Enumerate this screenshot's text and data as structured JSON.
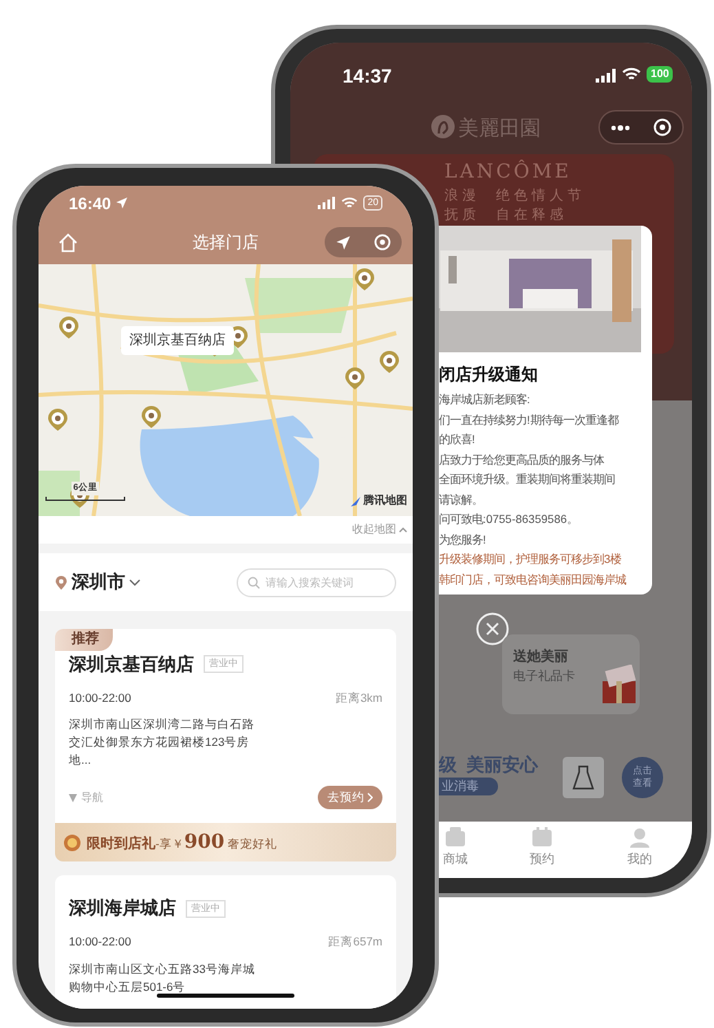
{
  "back_phone": {
    "status_bar": {
      "time": "14:37",
      "battery": "100"
    },
    "brand": "美麗田園",
    "banner": {
      "title": "LANCÔME",
      "lines": [
        "浪漫  绝色情人节",
        "抚质  自在释感"
      ]
    },
    "notice": {
      "title": "闭店升级通知",
      "lines": [
        {
          "text": "海岸城店新老顾客:",
          "kind": "normal"
        },
        {
          "text": "们一直在持续努力!期待每一次重逢都",
          "kind": "normal"
        },
        {
          "text": "的欣喜!",
          "kind": "normal"
        },
        {
          "text": "店致力于给您更高品质的服务与体",
          "kind": "normal"
        },
        {
          "text": "全面环境升级。重装期间将重装期间",
          "kind": "normal"
        },
        {
          "text": "请谅解。",
          "kind": "normal"
        },
        {
          "text": "问可致电:0755-86359586。",
          "kind": "normal"
        },
        {
          "text": "为您服务!",
          "kind": "normal"
        },
        {
          "text": "升级装修期间，护理服务可移步到3楼",
          "kind": "highlight"
        },
        {
          "text": "韩印门店，可致电咨询美丽田园海岸城",
          "kind": "highlight"
        }
      ]
    },
    "gift_card": {
      "title": "送她美丽",
      "subtitle": "电子礼品卡"
    },
    "safety": {
      "title": "级  美丽安心",
      "tag": "业消毒",
      "button": "点击查看"
    },
    "tab_bar": [
      {
        "label": "商城",
        "kind": "mall"
      },
      {
        "label": "预约",
        "kind": "booking"
      },
      {
        "label": "我的",
        "kind": "profile"
      }
    ]
  },
  "front_phone": {
    "status_bar": {
      "time": "16:40",
      "battery": "20"
    },
    "nav": {
      "title": "选择门店"
    },
    "map": {
      "callout": "深圳京基百纳店",
      "scale": "6公里",
      "attribution": "腾讯地图",
      "collapse": "收起地图"
    },
    "city": "深圳市",
    "search": {
      "placeholder": "请输入搜索关键词"
    },
    "stores": [
      {
        "badge": "推荐",
        "name": "深圳京基百纳店",
        "status": "营业中",
        "hours": "10:00-22:00",
        "distance": "距离3km",
        "address": "深圳市南山区深圳湾二路与白石路交汇处御景东方花园裙楼123号房地...",
        "navigate": "导航",
        "button": "去预约"
      },
      {
        "name": "深圳海岸城店",
        "status": "营业中",
        "hours": "10:00-22:00",
        "distance": "距离657m",
        "address": "深圳市南山区文心五路33号海岸城购物中心五层501-6号"
      }
    ],
    "promo": "**限时到店礼**-享￥**900** 奢宠好礼"
  }
}
